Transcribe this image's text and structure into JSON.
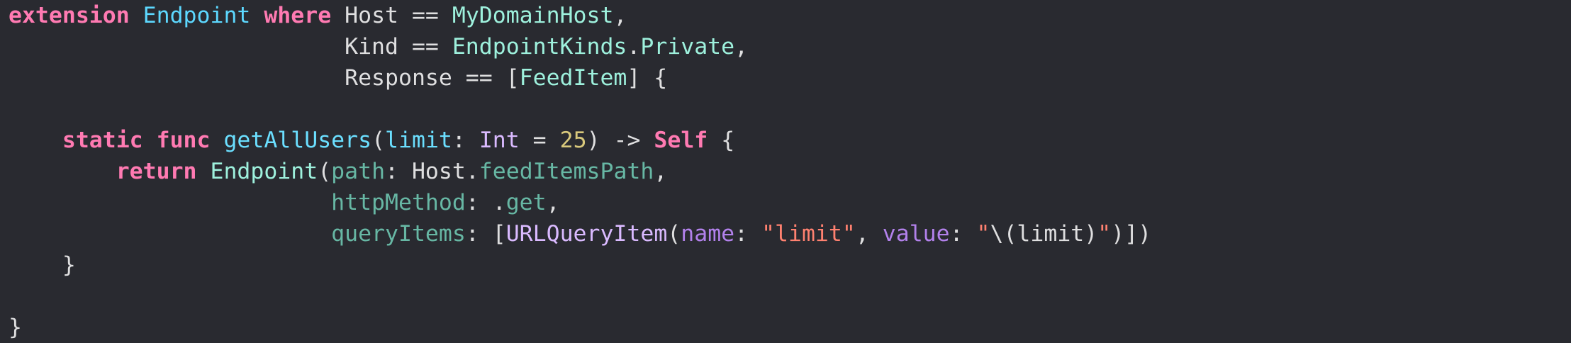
{
  "code": {
    "lines": [
      [
        {
          "t": "extension",
          "c": "kw"
        },
        {
          "t": " ",
          "c": "plain"
        },
        {
          "t": "Endpoint",
          "c": "type"
        },
        {
          "t": " ",
          "c": "plain"
        },
        {
          "t": "where",
          "c": "kw"
        },
        {
          "t": " Host == ",
          "c": "plain"
        },
        {
          "t": "MyDomainHost",
          "c": "proj"
        },
        {
          "t": ",",
          "c": "plain"
        }
      ],
      [
        {
          "t": "                         Kind == ",
          "c": "plain"
        },
        {
          "t": "EndpointKinds",
          "c": "proj"
        },
        {
          "t": ".",
          "c": "plain"
        },
        {
          "t": "Private",
          "c": "proj"
        },
        {
          "t": ",",
          "c": "plain"
        }
      ],
      [
        {
          "t": "                         Response == [",
          "c": "plain"
        },
        {
          "t": "FeedItem",
          "c": "proj"
        },
        {
          "t": "] {",
          "c": "plain"
        }
      ],
      [],
      [
        {
          "t": "    ",
          "c": "plain"
        },
        {
          "t": "static",
          "c": "kw"
        },
        {
          "t": " ",
          "c": "plain"
        },
        {
          "t": "func",
          "c": "kw"
        },
        {
          "t": " ",
          "c": "plain"
        },
        {
          "t": "getAllUsers",
          "c": "method"
        },
        {
          "t": "(",
          "c": "plain"
        },
        {
          "t": "limit",
          "c": "method"
        },
        {
          "t": ": ",
          "c": "plain"
        },
        {
          "t": "Int",
          "c": "sys"
        },
        {
          "t": " = ",
          "c": "plain"
        },
        {
          "t": "25",
          "c": "num"
        },
        {
          "t": ") -> ",
          "c": "plain"
        },
        {
          "t": "Self",
          "c": "kw"
        },
        {
          "t": " {",
          "c": "plain"
        }
      ],
      [
        {
          "t": "        ",
          "c": "plain"
        },
        {
          "t": "return",
          "c": "kw"
        },
        {
          "t": " ",
          "c": "plain"
        },
        {
          "t": "Endpoint",
          "c": "proj"
        },
        {
          "t": "(",
          "c": "plain"
        },
        {
          "t": "path",
          "c": "param"
        },
        {
          "t": ": Host.",
          "c": "plain"
        },
        {
          "t": "feedItemsPath",
          "c": "fn"
        },
        {
          "t": ",",
          "c": "plain"
        }
      ],
      [
        {
          "t": "                        ",
          "c": "plain"
        },
        {
          "t": "httpMethod",
          "c": "param"
        },
        {
          "t": ": .",
          "c": "plain"
        },
        {
          "t": "get",
          "c": "fn"
        },
        {
          "t": ",",
          "c": "plain"
        }
      ],
      [
        {
          "t": "                        ",
          "c": "plain"
        },
        {
          "t": "queryItems",
          "c": "param"
        },
        {
          "t": ": [",
          "c": "plain"
        },
        {
          "t": "URLQueryItem",
          "c": "sys"
        },
        {
          "t": "(",
          "c": "plain"
        },
        {
          "t": "name",
          "c": "sysproj"
        },
        {
          "t": ": ",
          "c": "plain"
        },
        {
          "t": "\"limit\"",
          "c": "str"
        },
        {
          "t": ", ",
          "c": "plain"
        },
        {
          "t": "value",
          "c": "sysproj"
        },
        {
          "t": ": ",
          "c": "plain"
        },
        {
          "t": "\"",
          "c": "str"
        },
        {
          "t": "\\(limit)",
          "c": "plain"
        },
        {
          "t": "\"",
          "c": "str"
        },
        {
          "t": ")])",
          "c": "plain"
        }
      ],
      [
        {
          "t": "    }",
          "c": "plain"
        }
      ],
      [],
      [
        {
          "t": "}",
          "c": "plain"
        }
      ]
    ]
  },
  "colors": {
    "background": "#292a30",
    "keyword": "#ff7ab2",
    "type": "#5dd8ff",
    "project_type": "#9ef1dd",
    "string": "#ff8170",
    "number": "#d9c97c",
    "system_type": "#dabaff",
    "plain": "#dfdfe0"
  }
}
